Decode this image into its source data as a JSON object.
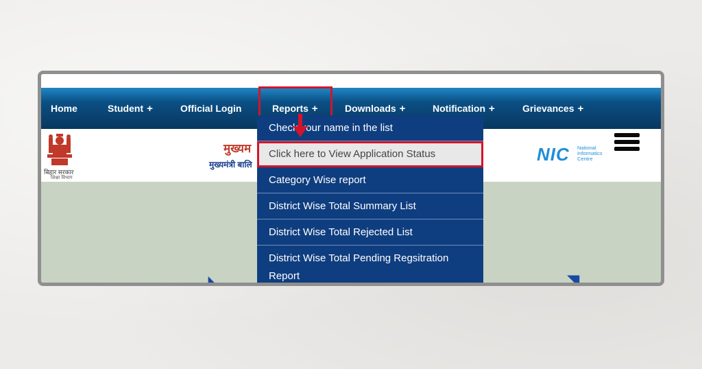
{
  "nav": {
    "items": [
      {
        "label": "Home",
        "plus": ""
      },
      {
        "label": "Student",
        "plus": "+"
      },
      {
        "label": "Official Login",
        "plus": ""
      },
      {
        "label": "Reports",
        "plus": "+"
      },
      {
        "label": "Downloads",
        "plus": "+"
      },
      {
        "label": "Notification",
        "plus": "+"
      },
      {
        "label": "Grievances",
        "plus": "+"
      }
    ]
  },
  "header": {
    "emblem_line1": "बिहार सरकार",
    "emblem_line2": "शिक्षा विभाग",
    "title_hindi": "मुख्यम",
    "subtitle_hindi": "मुख्यमंत्री बालि",
    "nic_logo": "NIC",
    "nic_line1": "National",
    "nic_line2": "Informatics",
    "nic_line3": "Centre"
  },
  "dropdown": {
    "items": [
      {
        "label": "Check your name in the list"
      },
      {
        "label": "Click here to View Application Status"
      },
      {
        "label": "Category Wise report"
      },
      {
        "label": "District Wise Total Summary List"
      },
      {
        "label": "District Wise Total Rejected List"
      },
      {
        "label": "District Wise Total Pending Regsitration Report"
      }
    ]
  },
  "colors": {
    "highlight": "#d4142a",
    "nav_dark": "#08375f",
    "nav_light": "#1f86c4",
    "dropdown_bg": "#0f3e80",
    "content_bg": "#c8d3c4"
  },
  "icons": [
    "emblem-icon",
    "hamburger-icon",
    "arrow-down-icon",
    "nic-logo-icon"
  ]
}
